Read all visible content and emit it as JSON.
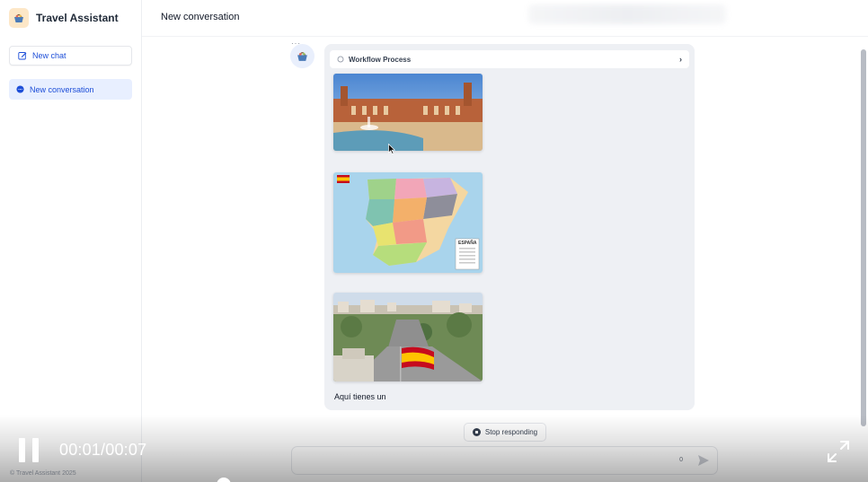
{
  "app": {
    "title": "Travel Assistant",
    "copyright": "© Travel Assistant 2025"
  },
  "sidebar": {
    "new_chat_label": "New chat",
    "conversations": [
      {
        "label": "New conversation",
        "active": true
      }
    ]
  },
  "header": {
    "title": "New conversation"
  },
  "message": {
    "workflow_label": "Workflow Process",
    "images": [
      {
        "name": "plaza-de-espana-photo"
      },
      {
        "name": "spain-political-map",
        "map_legend": "ESPAÑA"
      },
      {
        "name": "madrid-cityscape-photo"
      }
    ],
    "text": "Aquí tienes un"
  },
  "controls": {
    "stop_label": "Stop responding",
    "char_count": "0"
  },
  "video": {
    "time": "00:01/00:07",
    "progress": 0.14
  },
  "colors": {
    "accent": "#1d4ed8",
    "active_bg": "#e8efff",
    "bubble_bg": "#eef0f4"
  }
}
